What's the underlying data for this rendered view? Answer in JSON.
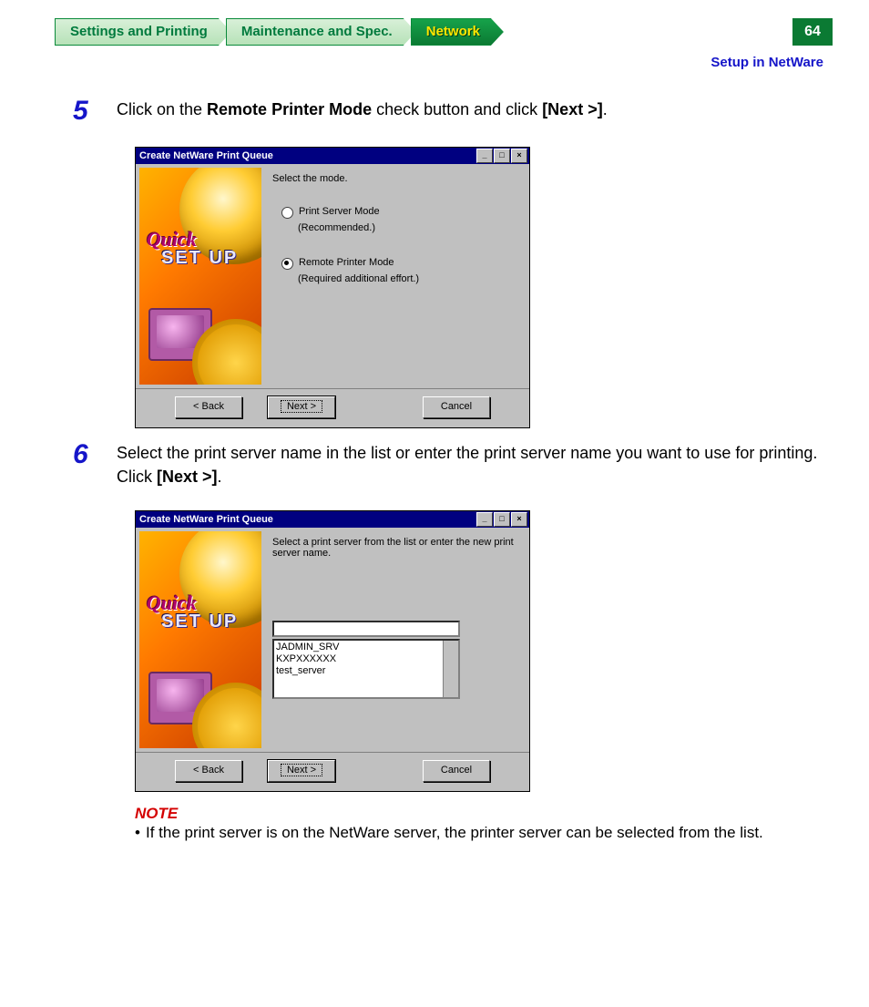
{
  "tabs": {
    "settings": "Settings and Printing",
    "maintenance": "Maintenance and Spec.",
    "network": "Network"
  },
  "page_number": "64",
  "breadcrumb": "Setup in NetWare",
  "steps": {
    "s5": {
      "num": "5",
      "pre": "Click on the ",
      "bold1": "Remote Printer Mode",
      "mid": " check button and click ",
      "bold2": "[Next >]",
      "post": "."
    },
    "s6": {
      "num": "6",
      "pre": "Select the print server name in the list or enter the print server name you want to use for printing. Click ",
      "bold1": "[Next >]",
      "post": "."
    }
  },
  "dialog": {
    "title": "Create NetWare Print Queue",
    "winbtn_min": "_",
    "winbtn_max": "□",
    "winbtn_close": "×",
    "side_quick": "Quick",
    "side_setup": "SET UP",
    "btn_back": "< Back",
    "btn_next": "Next >",
    "btn_cancel": "Cancel"
  },
  "dlg1": {
    "prompt": "Select the mode.",
    "opt1": "Print Server Mode",
    "opt1_sub": "(Recommended.)",
    "opt2": "Remote Printer Mode",
    "opt2_sub": "(Required additional effort.)"
  },
  "dlg2": {
    "prompt": "Select a print server from the list or enter the new print server name.",
    "items": {
      "i0": "JADMIN_SRV",
      "i1": "KXPXXXXXX",
      "i2": "test_server"
    }
  },
  "note": {
    "heading": "NOTE",
    "bullet": "•",
    "text": "If the print server is on the NetWare server, the printer server can be selected from the list."
  }
}
